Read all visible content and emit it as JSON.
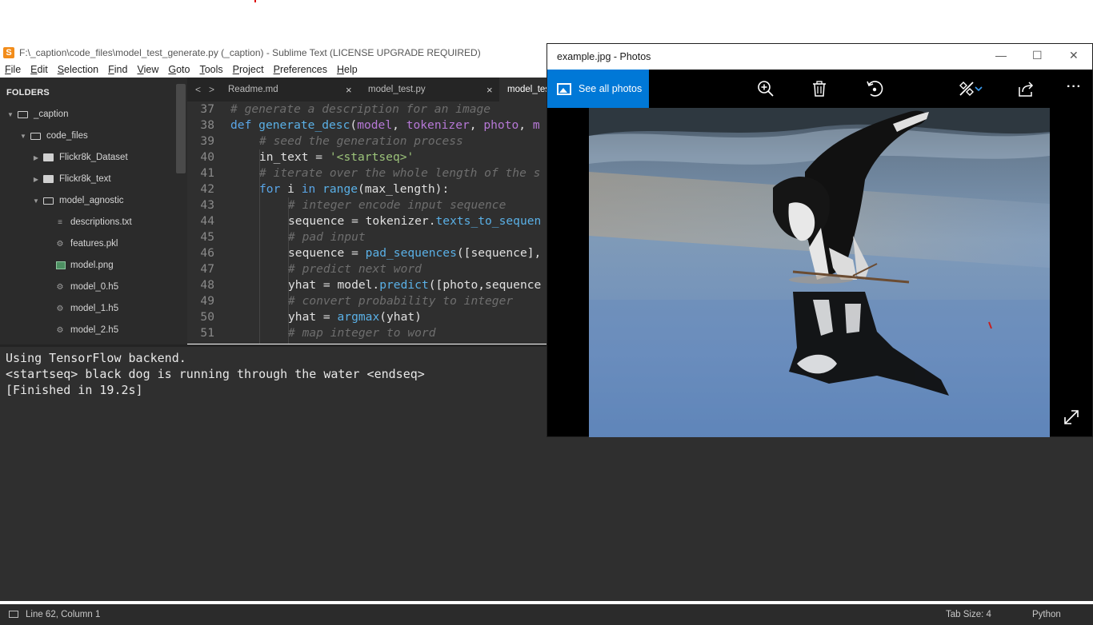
{
  "sublime": {
    "window_title": "F:\\_caption\\code_files\\model_test_generate.py (_caption) - Sublime Text (LICENSE UPGRADE REQUIRED)",
    "menu": [
      "File",
      "Edit",
      "Selection",
      "Find",
      "View",
      "Goto",
      "Tools",
      "Project",
      "Preferences",
      "Help"
    ],
    "sidebar": {
      "header": "FOLDERS",
      "items": [
        {
          "label": "_caption"
        },
        {
          "label": "code_files"
        },
        {
          "label": "Flickr8k_Dataset"
        },
        {
          "label": "Flickr8k_text"
        },
        {
          "label": "model_agnostic"
        },
        {
          "label": "descriptions.txt"
        },
        {
          "label": "features.pkl"
        },
        {
          "label": "model.png"
        },
        {
          "label": "model_0.h5"
        },
        {
          "label": "model_1.h5"
        },
        {
          "label": "model_2.h5"
        }
      ]
    },
    "tabs": [
      {
        "label": "Readme.md",
        "close": "×"
      },
      {
        "label": "model_test.py",
        "close": "×"
      },
      {
        "label": "model_tes"
      }
    ],
    "tab_nav": {
      "prev": "<",
      "next": ">"
    },
    "line_numbers": [
      "37",
      "38",
      "39",
      "40",
      "41",
      "42",
      "43",
      "44",
      "45",
      "46",
      "47",
      "48",
      "49",
      "50",
      "51"
    ],
    "code": {
      "l37": "# generate a description for an image",
      "l38_def": "def",
      "l38_fn": "generate_desc",
      "l38_open": "(",
      "l38_p1": "model",
      "l38_c1": ", ",
      "l38_p2": "tokenizer",
      "l38_c2": ", ",
      "l38_p3": "photo",
      "l38_c3": ", ",
      "l38_p4": "m",
      "l39": "# seed the generation process",
      "l40_a": "in_text = ",
      "l40_s": "'<startseq>'",
      "l41": "# iterate over the whole length of the s",
      "l42_for": "for",
      "l42_b": " i ",
      "l42_in": "in",
      "l42_c": " ",
      "l42_range": "range",
      "l42_d": "(max_length):",
      "l43": "# integer encode input sequence",
      "l44_a": "sequence = tokenizer.",
      "l44_f": "texts_to_sequen",
      "l45": "# pad input",
      "l46_a": "sequence = ",
      "l46_f": "pad_sequences",
      "l46_b": "([sequence],",
      "l47": "# predict next word",
      "l48_a": "yhat = model.",
      "l48_f": "predict",
      "l48_b": "([photo,sequence",
      "l49": "# convert probability to integer",
      "l50_a": "yhat = ",
      "l50_f": "argmax",
      "l50_b": "(yhat)",
      "l51": "# map integer to word"
    },
    "output": [
      "Using TensorFlow backend.",
      "<startseq> black dog is running through the water <endseq>",
      "[Finished in 19.2s]"
    ],
    "status": {
      "position": "Line 62, Column 1",
      "tab_size": "Tab Size: 4",
      "syntax": "Python"
    }
  },
  "photos": {
    "title": "example.jpg - Photos",
    "see_all": "See all photos",
    "toolbar_icons": [
      "zoom-in-icon",
      "delete-icon",
      "rotate-icon",
      "edit-create-icon",
      "share-icon",
      "more-icon"
    ],
    "more": "···",
    "window_buttons": {
      "minimize": "—",
      "maximize": "☐",
      "close": "✕"
    }
  },
  "colors": {
    "sublime_bg": "#2f2f2f",
    "sidebar_bg": "#2b2b2b",
    "accent_blue": "#0078d7",
    "comment": "#6e6e6e",
    "keyword": "#5aa6e8",
    "string": "#9cc37a",
    "param": "#b678d6"
  }
}
